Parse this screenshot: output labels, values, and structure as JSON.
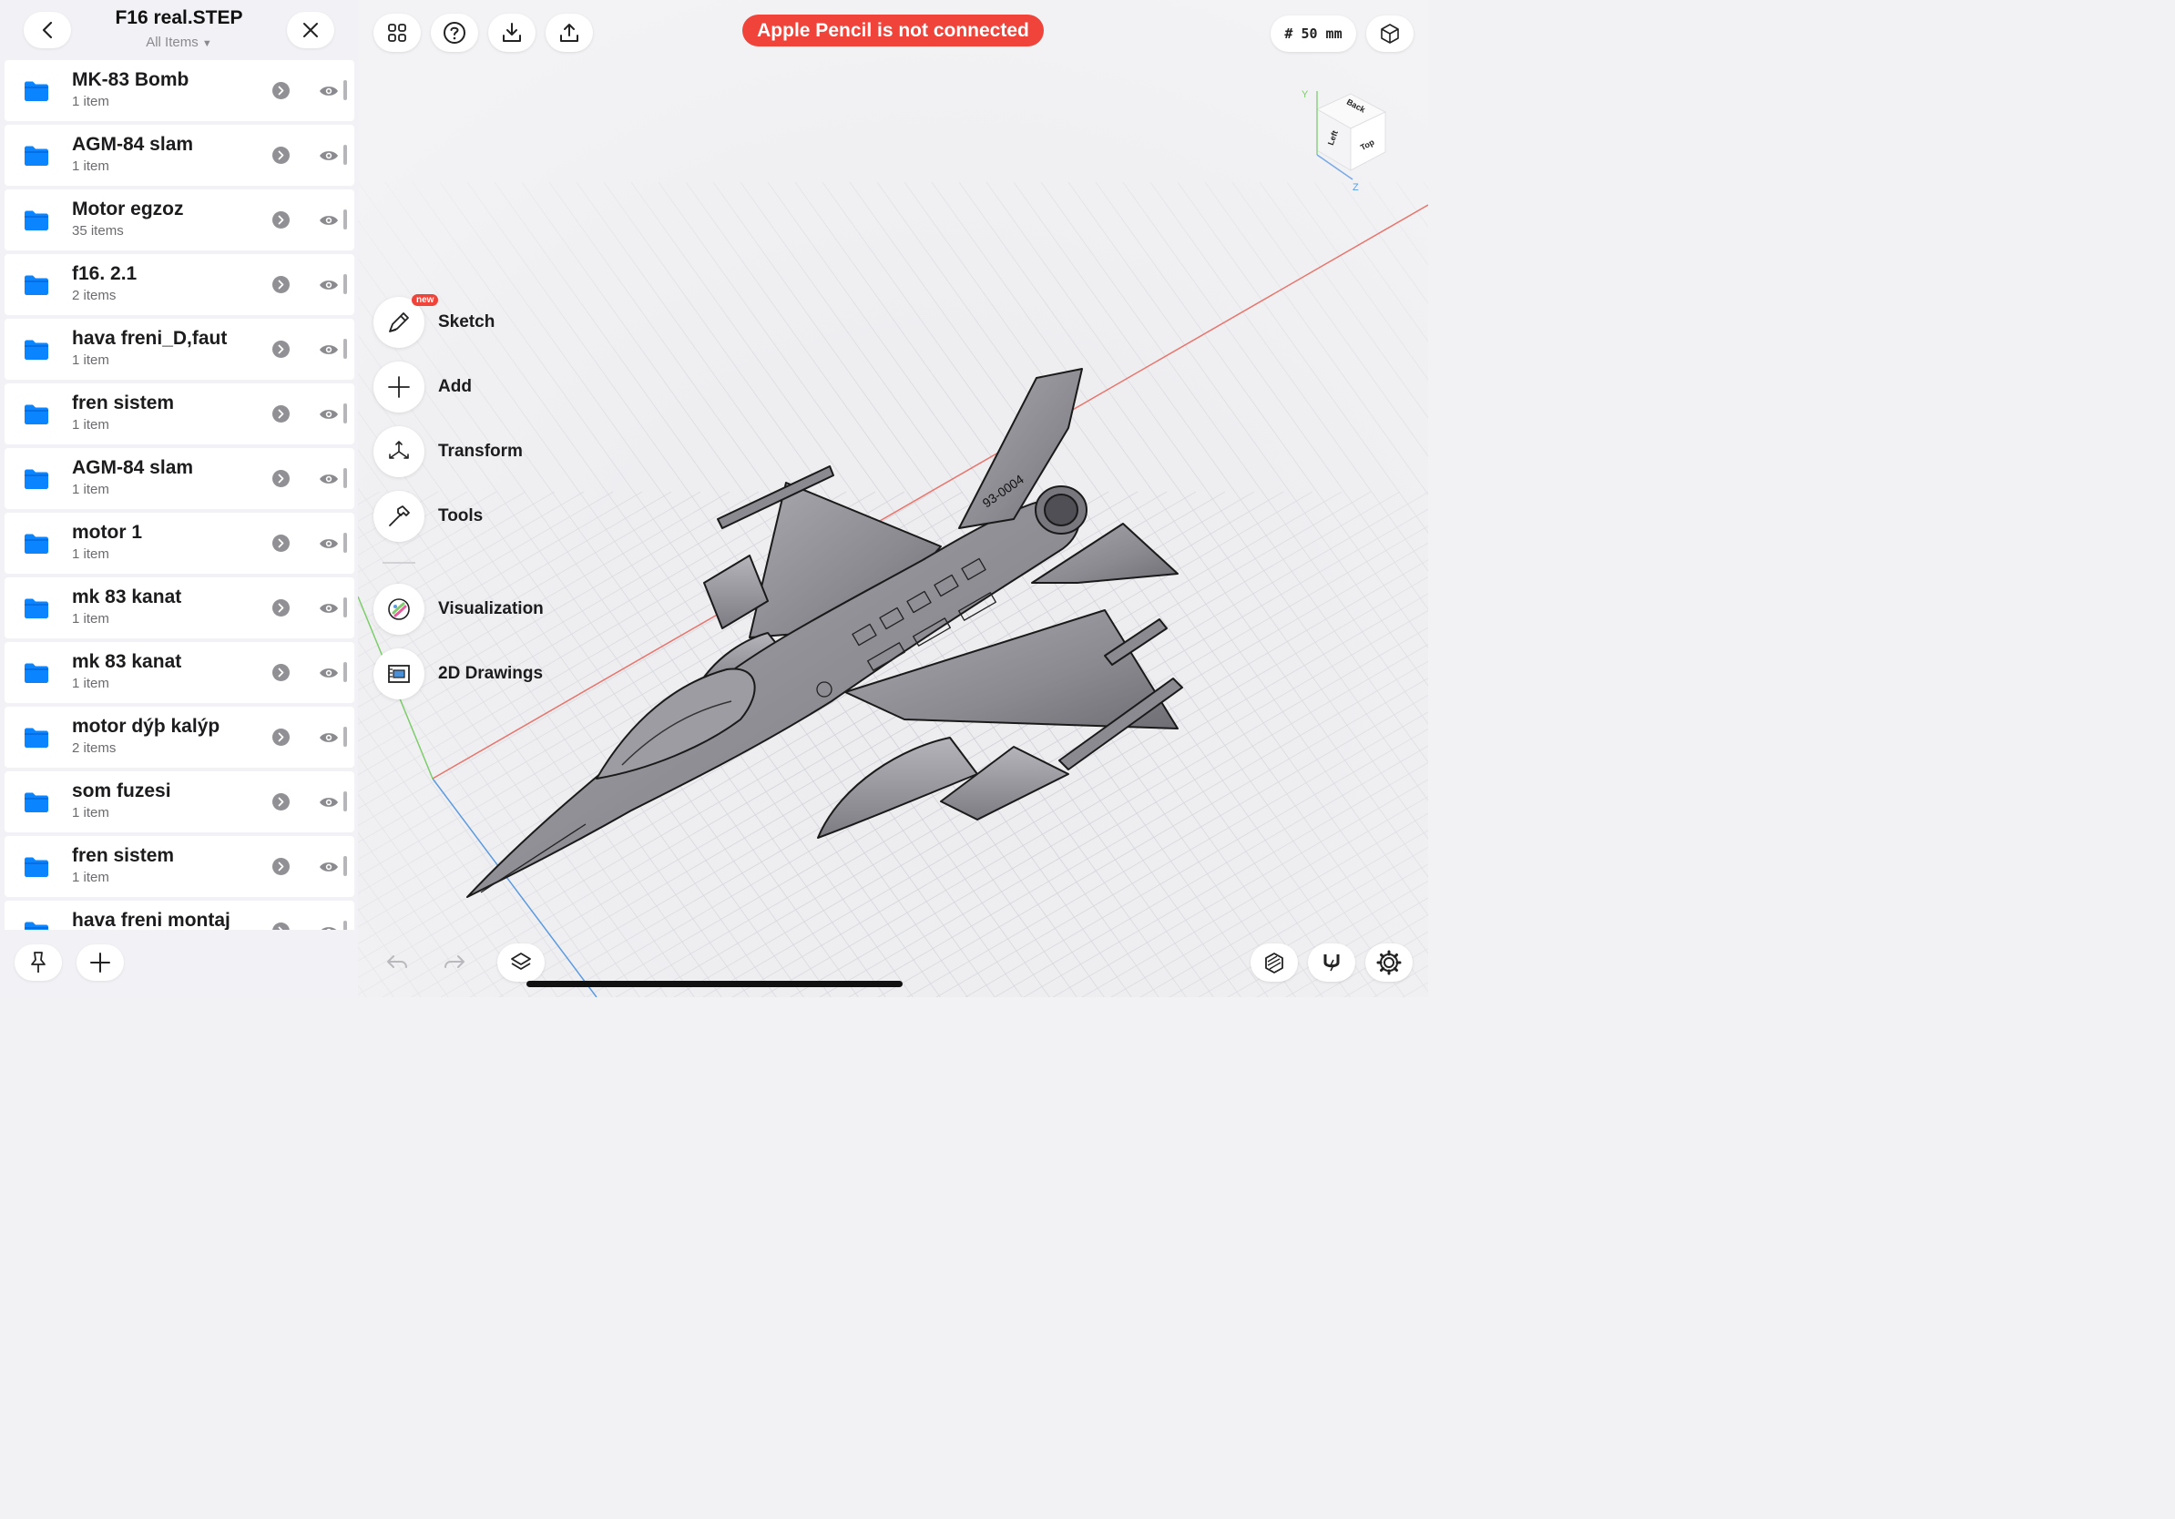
{
  "sidebar": {
    "title": "F16 real.STEP",
    "subtitle": "All Items",
    "items": [
      {
        "name": "MK-83 Bomb",
        "count": "1 item"
      },
      {
        "name": "AGM-84 slam",
        "count": "1 item"
      },
      {
        "name": "Motor egzoz",
        "count": "35 items"
      },
      {
        "name": "f16. 2.1",
        "count": "2 items"
      },
      {
        "name": "hava freni_D,faut",
        "count": "1 item"
      },
      {
        "name": "fren sistem",
        "count": "1 item"
      },
      {
        "name": "AGM-84 slam",
        "count": "1 item"
      },
      {
        "name": "motor 1",
        "count": "1 item"
      },
      {
        "name": "mk 83 kanat",
        "count": "1 item"
      },
      {
        "name": "mk 83 kanat",
        "count": "1 item"
      },
      {
        "name": "motor dýþ kalýp",
        "count": "2 items"
      },
      {
        "name": "som fuzesi",
        "count": "1 item"
      },
      {
        "name": "fren sistem",
        "count": "1 item"
      },
      {
        "name": "hava freni montaj",
        "count": ""
      }
    ]
  },
  "toolbar": {
    "banner": "Apple Pencil is not connected",
    "grid_size": "# 50 mm"
  },
  "tools": [
    {
      "label": "Sketch",
      "badge": "new"
    },
    {
      "label": "Add"
    },
    {
      "label": "Transform"
    },
    {
      "label": "Tools"
    },
    {
      "label": "Visualization"
    },
    {
      "label": "2D Drawings"
    }
  ],
  "view_cube": {
    "faces": [
      "Back",
      "Left",
      "Top"
    ],
    "axes": [
      "Y",
      "Z"
    ]
  },
  "model": {
    "tail_number": "93-0004"
  },
  "colors": {
    "folder": "#0a84ff",
    "banner": "#f0433a",
    "x_axis": "#e8746c",
    "y_axis": "#7ccc6a",
    "z_axis": "#5b9be0"
  },
  "icons": [
    "back-icon",
    "close-icon",
    "grid-icon",
    "help-icon",
    "import-icon",
    "export-icon",
    "view-cube-icon",
    "folder-icon",
    "chevron-right-icon",
    "eye-icon",
    "pin-icon",
    "plus-icon",
    "sketch-icon",
    "transform-icon",
    "hammer-icon",
    "visualization-icon",
    "drawings-icon",
    "undo-icon",
    "redo-icon",
    "layers-icon",
    "material-icon",
    "magnet-icon",
    "gear-icon"
  ]
}
